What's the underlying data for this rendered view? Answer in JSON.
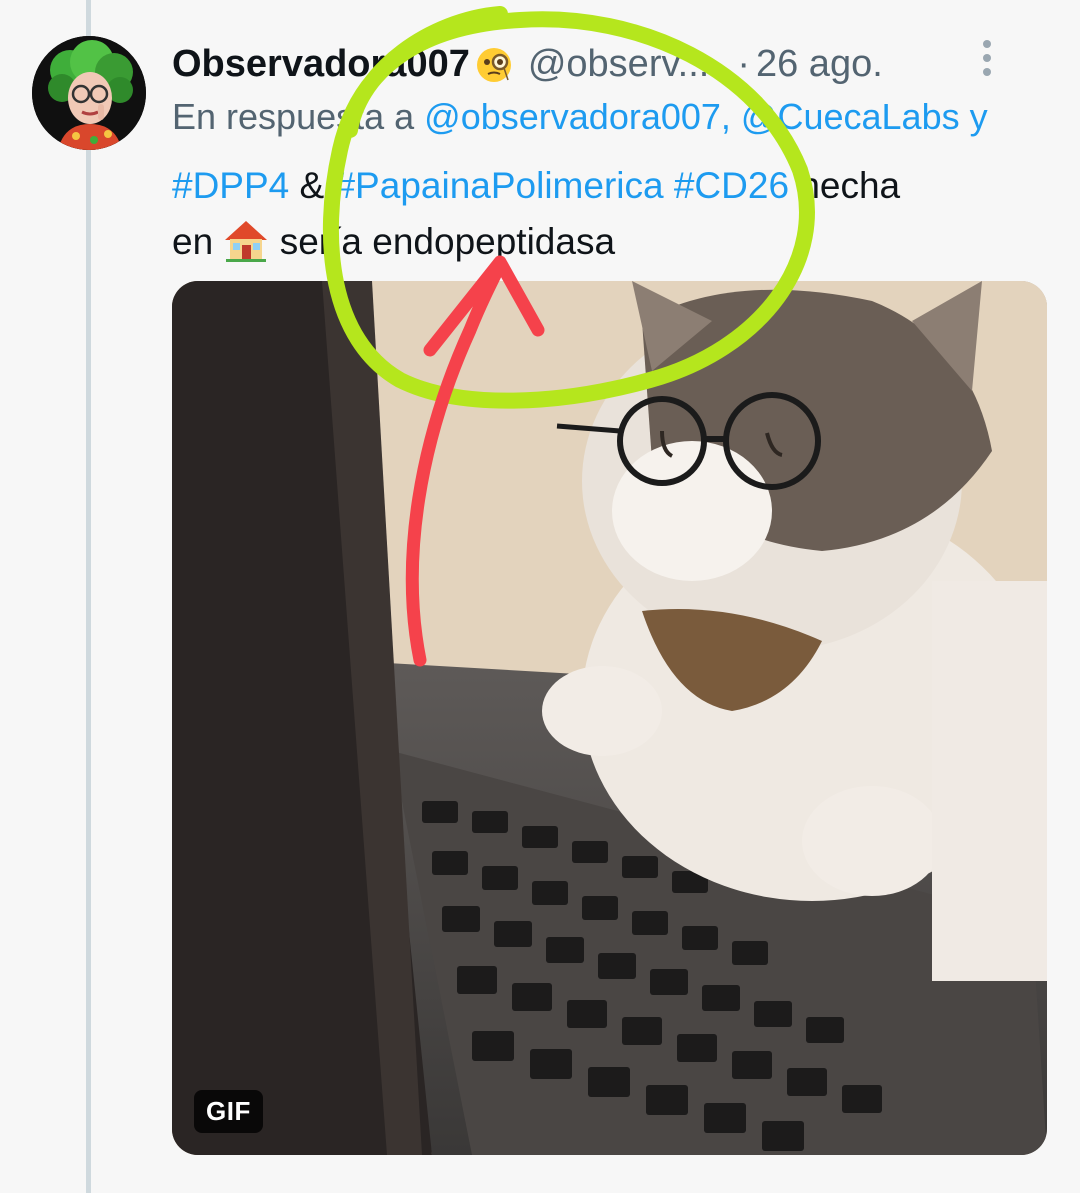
{
  "tweet": {
    "author": {
      "display_name": "Observadora007",
      "name_emoji": "monocle-face-emoji",
      "handle": "@observ...",
      "avatar": "avatar-illustration"
    },
    "separator": "·",
    "date": "26 ago.",
    "reply_to": {
      "prefix": "En respuesta a",
      "mentions": "@observadora007, @CuecaLabs y"
    },
    "body": {
      "hashtag_1": "#DPP4",
      "conjunction": "&",
      "hashtag_2": "#PapainaPolimerica",
      "hashtag_3": "#CD26",
      "text_1": "hecha",
      "text_2": "en",
      "house_emoji": "house-emoji",
      "text_3": "sería endopeptidasa"
    },
    "media": {
      "badge": "GIF",
      "description_icon": "cat-with-glasses-laptop-gif"
    }
  },
  "annotations": {
    "circle_color": "#b5e61d",
    "arrow_color": "#f5424b"
  },
  "colors": {
    "link": "#1d9bf0",
    "secondary_text": "#536471",
    "primary_text": "#0f1419",
    "background": "#f7f7f7",
    "thread_line": "#cfd9de"
  }
}
